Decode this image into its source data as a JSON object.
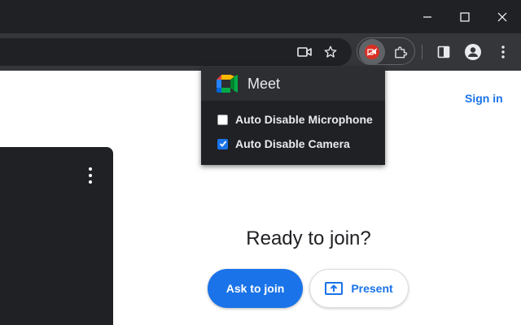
{
  "window": {
    "minimize_icon": "minimize-icon",
    "maximize_icon": "maximize-icon",
    "close_icon": "close-icon"
  },
  "toolbar": {
    "icons": [
      "camera-icon",
      "bookmark-star-icon",
      "extension-icon",
      "puzzle-icon",
      "side-panel-icon",
      "profile-icon",
      "menu-dots-icon"
    ]
  },
  "popup": {
    "title": "Meet",
    "options": [
      {
        "label": "Auto Disable Microphone",
        "checked": false
      },
      {
        "label": "Auto Disable Camera",
        "checked": true
      }
    ]
  },
  "page": {
    "sign_in": "Sign in",
    "heading": "Ready to join?",
    "ask_button": "Ask to join",
    "present_button": "Present"
  },
  "colors": {
    "accent": "#1a73e8",
    "titlebar": "#202124",
    "toolbar": "#35363a",
    "badge": "#d93025"
  }
}
